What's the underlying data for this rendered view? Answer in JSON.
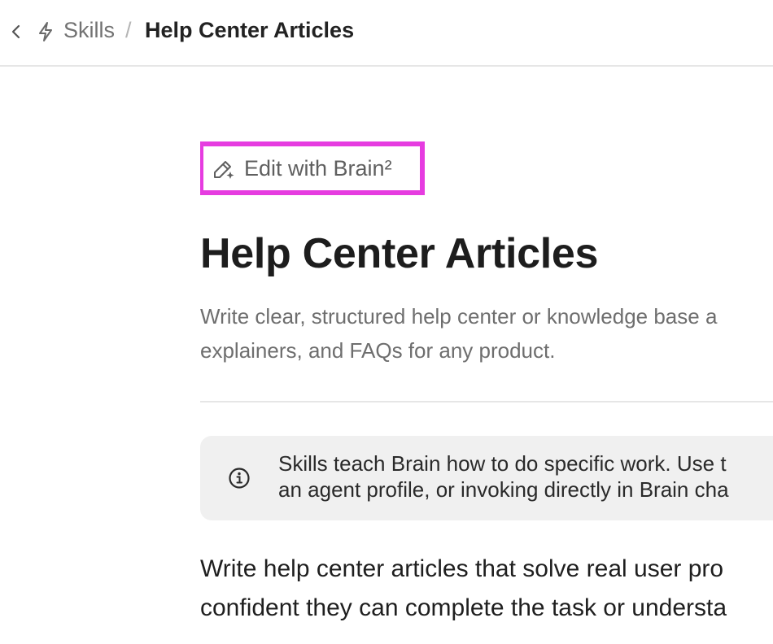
{
  "breadcrumb": {
    "back_icon": "chevron-left-icon",
    "section_icon": "lightning-bolt-icon",
    "section": "Skills",
    "separator": "/",
    "current": "Help Center Articles"
  },
  "edit_button": {
    "icon": "pencil-sparkle-icon",
    "label": "Edit with Brain²",
    "highlight_color": "#e63ce0"
  },
  "page": {
    "title": "Help Center Articles",
    "description_lines": [
      "Write clear, structured help center or knowledge base a",
      "explainers, and FAQs for any product."
    ]
  },
  "info_box": {
    "icon": "info-circle-icon",
    "lines": [
      "Skills teach Brain how to do specific work. Use t",
      "an agent profile, or invoking directly in Brain cha"
    ]
  },
  "body": {
    "lines": [
      "Write help center articles that solve real user pro",
      "confident they can complete the task or understa"
    ]
  }
}
